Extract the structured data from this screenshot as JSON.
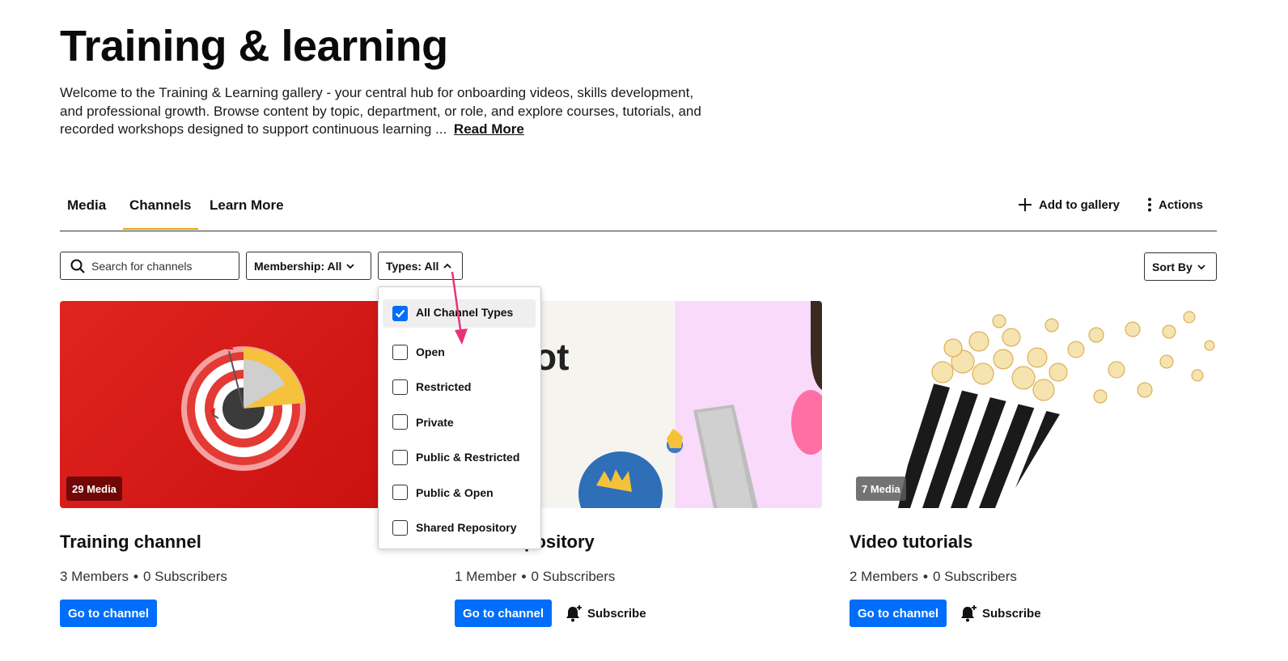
{
  "header": {
    "title": "Training & learning",
    "description": "Welcome to the Training & Learning gallery - your central hub for onboarding videos, skills development, and professional growth. Browse content by topic, department, or role, and explore courses, tutorials, and recorded workshops designed to support continuous learning ...",
    "read_more": "Read More"
  },
  "tabs": [
    {
      "label": "Media"
    },
    {
      "label": "Channels",
      "active": true
    },
    {
      "label": "Learn More"
    }
  ],
  "gallery_actions": {
    "add_label": "Add to gallery",
    "actions_label": "Actions"
  },
  "filters": {
    "search_placeholder": "Search for channels",
    "membership_label": "Membership: All",
    "types_label": "Types: All",
    "sort_label": "Sort By"
  },
  "types_dropdown": {
    "options": [
      {
        "label": "All Channel Types",
        "checked": true
      },
      {
        "label": "Open",
        "checked": false
      },
      {
        "label": "Restricted",
        "checked": false
      },
      {
        "label": "Private",
        "checked": false
      },
      {
        "label": "Public & Restricted",
        "checked": false
      },
      {
        "label": "Public & Open",
        "checked": false
      },
      {
        "label": "Shared Repository",
        "checked": false
      }
    ]
  },
  "cards": [
    {
      "title": "Training channel",
      "media_badge": "29 Media",
      "members": "3 Members",
      "subscribers": "0 Subscribers",
      "go_label": "Go to channel",
      "subscribe_label": ""
    },
    {
      "title": "pository",
      "thumb_text": "ot",
      "media_badge": "",
      "members": "1 Member",
      "subscribers": "0 Subscribers",
      "go_label": "Go to channel",
      "subscribe_label": "Subscribe"
    },
    {
      "title": "Video tutorials",
      "media_badge": "7 Media",
      "members": "2 Members",
      "subscribers": "0 Subscribers",
      "go_label": "Go to channel",
      "subscribe_label": "Subscribe"
    }
  ],
  "colors": {
    "primary": "#006efa",
    "tab_underline": "#e5a600",
    "annotation_arrow": "#e8327c"
  }
}
